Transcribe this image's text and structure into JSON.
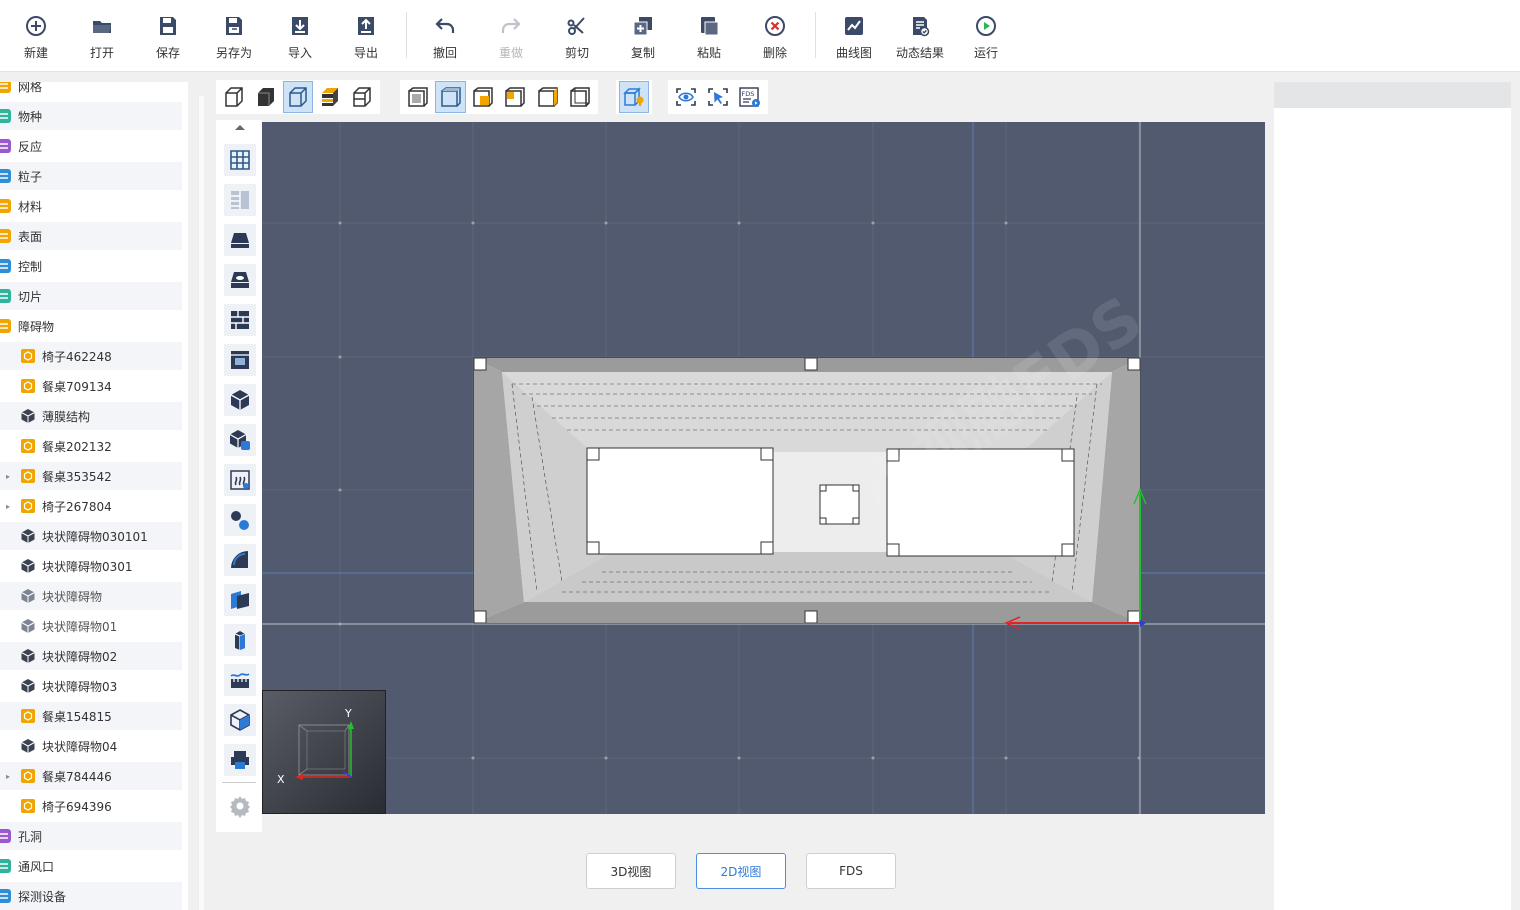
{
  "toolbar": {
    "items": [
      {
        "label": "新建",
        "icon": "plus-circle-icon",
        "enabled": true
      },
      {
        "label": "打开",
        "icon": "folder-open-icon",
        "enabled": true
      },
      {
        "label": "保存",
        "icon": "save-icon",
        "enabled": true
      },
      {
        "label": "另存为",
        "icon": "save-as-icon",
        "enabled": true
      },
      {
        "label": "导入",
        "icon": "import-icon",
        "enabled": true
      },
      {
        "label": "导出",
        "icon": "export-icon",
        "enabled": true
      },
      {
        "label": "撤回",
        "icon": "undo-icon",
        "enabled": true
      },
      {
        "label": "重做",
        "icon": "redo-icon",
        "enabled": false
      },
      {
        "label": "剪切",
        "icon": "scissors-icon",
        "enabled": true
      },
      {
        "label": "复制",
        "icon": "copy-icon",
        "enabled": true
      },
      {
        "label": "粘贴",
        "icon": "paste-icon",
        "enabled": true
      },
      {
        "label": "删除",
        "icon": "delete-icon",
        "enabled": true
      },
      {
        "label": "曲线图",
        "icon": "line-chart-icon",
        "enabled": true
      },
      {
        "label": "动态结果",
        "icon": "dynamic-result-icon",
        "enabled": true
      },
      {
        "label": "运行",
        "icon": "run-icon",
        "enabled": true
      }
    ]
  },
  "tree": {
    "items": [
      {
        "label": "网格",
        "level": 0,
        "color": "#f0a500",
        "kind": "partial"
      },
      {
        "label": "物种",
        "level": 0,
        "color": "#2fb39c"
      },
      {
        "label": "反应",
        "level": 0,
        "color": "#9b59d0"
      },
      {
        "label": "粒子",
        "level": 0,
        "color": "#2f8fd6"
      },
      {
        "label": "材料",
        "level": 0,
        "color": "#f0a500"
      },
      {
        "label": "表面",
        "level": 0,
        "color": "#f0a500"
      },
      {
        "label": "控制",
        "level": 0,
        "color": "#2f8fd6"
      },
      {
        "label": "切片",
        "level": 0,
        "color": "#2fb39c"
      },
      {
        "label": "障碍物",
        "level": 0,
        "color": "#f0a500"
      },
      {
        "label": "椅子462248",
        "level": 1,
        "type": "furniture"
      },
      {
        "label": "餐桌709134",
        "level": 1,
        "type": "furniture"
      },
      {
        "label": "薄膜结构",
        "level": 1,
        "type": "block"
      },
      {
        "label": "餐桌202132",
        "level": 1,
        "type": "furniture"
      },
      {
        "label": "餐桌353542",
        "level": 1,
        "type": "furniture",
        "caret": true
      },
      {
        "label": "椅子267804",
        "level": 1,
        "type": "furniture",
        "caret": true
      },
      {
        "label": "块状障碍物030101",
        "level": 1,
        "type": "block"
      },
      {
        "label": "块状障碍物0301",
        "level": 1,
        "type": "block"
      },
      {
        "label": "块状障碍物",
        "level": 1,
        "type": "block-light"
      },
      {
        "label": "块状障碍物01",
        "level": 1,
        "type": "block-light"
      },
      {
        "label": "块状障碍物02",
        "level": 1,
        "type": "block"
      },
      {
        "label": "块状障碍物03",
        "level": 1,
        "type": "block"
      },
      {
        "label": "餐桌154815",
        "level": 1,
        "type": "furniture"
      },
      {
        "label": "块状障碍物04",
        "level": 1,
        "type": "block"
      },
      {
        "label": "餐桌784446",
        "level": 1,
        "type": "furniture",
        "caret": true
      },
      {
        "label": "椅子694396",
        "level": 1,
        "type": "furniture"
      },
      {
        "label": "孔洞",
        "level": 0,
        "color": "#9b59d0"
      },
      {
        "label": "通风口",
        "level": 0,
        "color": "#2fb39c"
      },
      {
        "label": "探测设备",
        "level": 0,
        "color": "#2f8fd6"
      }
    ]
  },
  "minimap": {
    "x_label": "X",
    "y_label": "Y"
  },
  "tabs": [
    {
      "label": "3D视图",
      "active": false
    },
    {
      "label": "2D视图",
      "active": true
    },
    {
      "label": "FDS",
      "active": false
    }
  ],
  "watermark": {
    "text": "小视融FDS"
  },
  "colors": {
    "accent": "#2d7ad6",
    "canvas": "#525a70",
    "folder": "#f0a500"
  }
}
